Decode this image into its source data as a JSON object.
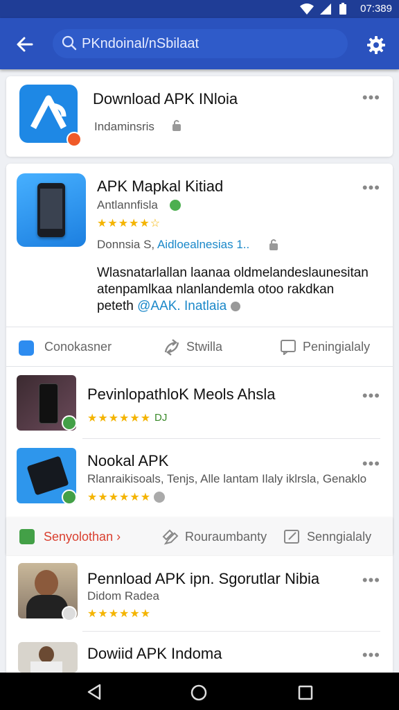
{
  "status": {
    "time": "07:389"
  },
  "search": {
    "text": "PKndoinal/nSbilaat"
  },
  "card1": {
    "title": "Download APK INloia",
    "subtitle": "Indaminsris"
  },
  "card2": {
    "title": "APK Mapkal Kitiad",
    "publisher": "Antlannfisla",
    "rating": "★★★★★☆",
    "meta_left": "Donnsia S,",
    "meta_link": "Aidloealnesias 1..",
    "desc_line1": "Wlasnatarlallan laanaa oldmelandeslaunesitan",
    "desc_line2": "atenpamlkaa nlanlandemla otoo rakdkan",
    "desc_line3_prefix": "peteth ",
    "desc_line3_link": "@AAK. Inatlaia"
  },
  "bar1": {
    "item1": "Conokasner",
    "item2": "Stwilla",
    "item3": "Peningialaly"
  },
  "list1": [
    {
      "title": "PevinlopathloK Meols Ahsla",
      "rating": "★★★★★★",
      "extra": "DJ"
    },
    {
      "title": "Nookal APK",
      "subtitle": "Rlanraikisoals, Tenjs, Alle lantam Ilaly iklrsla, Genaklo",
      "rating": "★★★★★★"
    }
  ],
  "bar2": {
    "item1": "Senyolothan ›",
    "item2": "Rouraumbanty",
    "item3": "Senngialaly"
  },
  "list2": [
    {
      "title": "Pennload APK ipn. Sgorutlar Nibia",
      "subtitle": "Didom Radea",
      "rating": "★★★★★★"
    },
    {
      "title": "Dowiid APK Indoma"
    }
  ],
  "colors": {
    "appbar": "#2a52be",
    "status": "#1f3d96",
    "accent": "#1a88c9",
    "star": "#f4b400",
    "bar2_accent": "#d93f2f"
  }
}
